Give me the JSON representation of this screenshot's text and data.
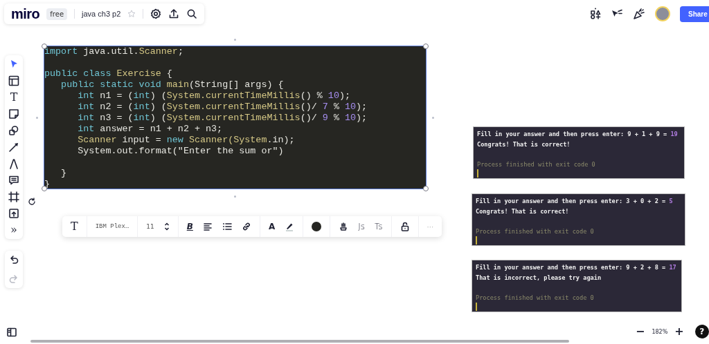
{
  "header": {
    "logo": "miro",
    "plan_badge": "free",
    "board_name": "java ch3 p2",
    "share_button": "Share"
  },
  "tools": [
    {
      "selected": true
    },
    {
      "selected": false
    },
    {
      "selected": false,
      "glyph": "T"
    },
    {
      "selected": false
    },
    {
      "selected": false
    },
    {
      "selected": false
    },
    {
      "selected": false
    },
    {
      "selected": false
    },
    {
      "selected": false
    },
    {
      "selected": false
    },
    {
      "selected": false,
      "glyph": "»"
    }
  ],
  "history": [
    {
      "kind": "undo",
      "disabled": false
    },
    {
      "kind": "redo",
      "disabled": true
    }
  ],
  "code_block": {
    "paragraphs": [
      {
        "lines": [
          [
            {
              "kind": "keyword",
              "text": "import"
            },
            {
              "kind": "plain",
              "text": " java.util."
            },
            {
              "kind": "type",
              "text": "Scanner"
            },
            {
              "kind": "plain",
              "text": ";"
            }
          ]
        ]
      },
      {
        "lines": [
          [
            {
              "kind": "keyword",
              "text": "public class"
            },
            {
              "kind": "type",
              "text": " Exercise"
            },
            {
              "kind": "plain",
              "text": " {"
            }
          ],
          [
            {
              "kind": "keyword",
              "text": "   public static void"
            },
            {
              "kind": "type",
              "text": " main"
            },
            {
              "kind": "plain",
              "text": "(String[] args) {"
            }
          ],
          [
            {
              "kind": "keyword",
              "text": "      int"
            },
            {
              "kind": "plain",
              "text": " n1 = ("
            },
            {
              "kind": "keyword",
              "text": "int"
            },
            {
              "kind": "plain",
              "text": ") ("
            },
            {
              "kind": "type",
              "text": "System.currentTimeMillis"
            },
            {
              "kind": "plain",
              "text": "() % "
            },
            {
              "kind": "number",
              "text": "10"
            },
            {
              "kind": "plain",
              "text": ");"
            }
          ],
          [
            {
              "kind": "keyword",
              "text": "      int"
            },
            {
              "kind": "plain",
              "text": " n2 = ("
            },
            {
              "kind": "keyword",
              "text": "int"
            },
            {
              "kind": "plain",
              "text": ") ("
            },
            {
              "kind": "type",
              "text": "System.currentTimeMillis"
            },
            {
              "kind": "plain",
              "text": "()/ "
            },
            {
              "kind": "number",
              "text": "7"
            },
            {
              "kind": "plain",
              "text": " % "
            },
            {
              "kind": "number",
              "text": "10"
            },
            {
              "kind": "plain",
              "text": ");"
            }
          ],
          [
            {
              "kind": "keyword",
              "text": "      int"
            },
            {
              "kind": "plain",
              "text": " n3 = ("
            },
            {
              "kind": "keyword",
              "text": "int"
            },
            {
              "kind": "plain",
              "text": ") ("
            },
            {
              "kind": "type",
              "text": "System.currentTimeMillis"
            },
            {
              "kind": "plain",
              "text": "()/ "
            },
            {
              "kind": "number",
              "text": "9"
            },
            {
              "kind": "plain",
              "text": " % "
            },
            {
              "kind": "number",
              "text": "10"
            },
            {
              "kind": "plain",
              "text": ");"
            }
          ],
          [
            {
              "kind": "keyword",
              "text": "      int"
            },
            {
              "kind": "plain",
              "text": " answer = n1 + n2 + n3;"
            }
          ],
          [
            {
              "kind": "type",
              "text": "      Scanner"
            },
            {
              "kind": "plain",
              "text": " input = "
            },
            {
              "kind": "keyword",
              "text": "new"
            },
            {
              "kind": "type",
              "text": " Scanner(System"
            },
            {
              "kind": "plain",
              "text": ".in);"
            }
          ],
          [
            {
              "kind": "plain",
              "text": "      System.out.format(\"Enter the sum or\")"
            }
          ]
        ]
      },
      {
        "lines": [
          [
            {
              "kind": "plain",
              "text": "   }"
            }
          ],
          [
            {
              "kind": "plain",
              "text": "}"
            }
          ]
        ]
      }
    ]
  },
  "format_toolbar": {
    "text_tool": "T",
    "font": "IBM Plex…",
    "size": "11",
    "bold": "B",
    "text_color": "A",
    "languages": [
      "Js",
      "Ts"
    ],
    "more": "···"
  },
  "terminals": [
    {
      "prompt": "Fill in your answer and then press enter: 9 + 1 + 9 = ",
      "answer": "19",
      "message": "Congrats! That is correct!",
      "status": "Process finished with exit code 0"
    },
    {
      "prompt": "Fill in your answer and then press enter: 3 + 0 + 2 = ",
      "answer": "5",
      "message": "Congrats! That is correct!",
      "status": "Process finished with exit code 0"
    },
    {
      "prompt": "Fill in your answer and then press enter: 9 + 2 + 8 = ",
      "answer": "17",
      "message": "That is incorrect, please try again",
      "status": "Process finished with exit code 0"
    }
  ],
  "zoom": {
    "minus": "−",
    "level": "182%",
    "plus": "+",
    "help": "?"
  }
}
